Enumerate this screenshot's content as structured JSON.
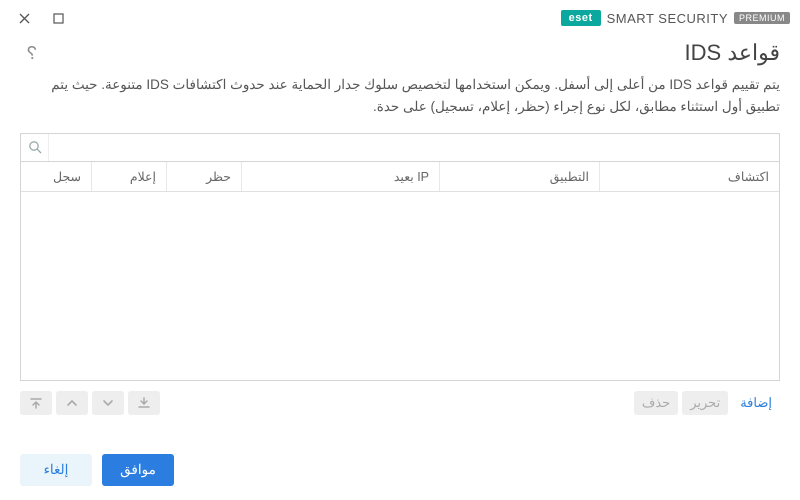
{
  "brand": {
    "eset": "eset",
    "product": "SMART SECURITY",
    "tier": "PREMIUM"
  },
  "page": {
    "title": "قواعد IDS",
    "description": "يتم تقييم قواعد IDS من أعلى إلى أسفل. ويمكن استخدامها لتخصيص سلوك جدار الحماية عند حدوث اكتشافات IDS متنوعة. حيث يتم تطبيق أول استثناء مطابق، لكل نوع إجراء (حظر، إعلام، تسجيل) على حدة."
  },
  "search": {
    "placeholder": ""
  },
  "columns": {
    "detection": "اكتشاف",
    "application": "التطبيق",
    "remote_ip": "IP بعيد",
    "block": "حظر",
    "notify": "إعلام",
    "log": "سجل"
  },
  "actions": {
    "add": "إضافة",
    "edit": "تحرير",
    "delete": "حذف"
  },
  "footer": {
    "ok": "موافق",
    "cancel": "إلغاء"
  }
}
